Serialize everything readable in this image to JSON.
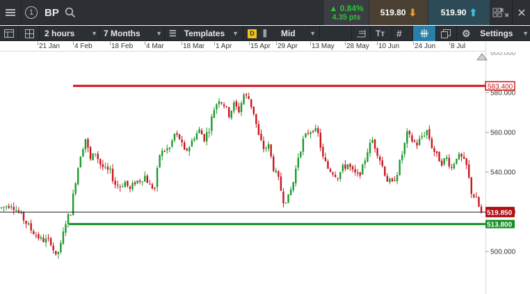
{
  "header": {
    "instrument_number": "1",
    "symbol": "BP",
    "change_pct": "0.84%",
    "change_pts": "4.35 pts",
    "sell_price": "519.80",
    "buy_price": "519.90"
  },
  "toolbar": {
    "interval": "2 hours",
    "range": "7 Months",
    "templates_label": "Templates",
    "d_badge": "D",
    "price_type": "Mid",
    "settings_label": "Settings"
  },
  "colors": {
    "up_candle": "#1a9a2a",
    "down_candle": "#c8141c",
    "resistance": "#d41016",
    "support": "#138f21",
    "current": "#b01012"
  },
  "chart_data": {
    "type": "candlestick",
    "x_tick_labels": [
      "21 Jan",
      "4 Feb",
      "18 Feb",
      "4 Mar",
      "18 Mar",
      "1 Apr",
      "15 Apr",
      "29 Apr",
      "13 May",
      "28 May",
      "10 Jun",
      "24 Jun",
      "8 Jul"
    ],
    "y_tick_labels": [
      "500.000",
      "520.000",
      "540.000",
      "560.000",
      "580.000",
      "600.000"
    ],
    "ylim": [
      487,
      604
    ],
    "anchors": [
      [
        0,
        522
      ],
      [
        4,
        524
      ],
      [
        8,
        518
      ],
      [
        12,
        511
      ],
      [
        16,
        506
      ],
      [
        20,
        505
      ],
      [
        22,
        497
      ],
      [
        24,
        503
      ],
      [
        26,
        515
      ],
      [
        28,
        520
      ],
      [
        30,
        536
      ],
      [
        32,
        549
      ],
      [
        34,
        557
      ],
      [
        36,
        546
      ],
      [
        38,
        550
      ],
      [
        40,
        544
      ],
      [
        42,
        541
      ],
      [
        44,
        540
      ],
      [
        46,
        534
      ],
      [
        48,
        533
      ],
      [
        50,
        535
      ],
      [
        52,
        531
      ],
      [
        54,
        535
      ],
      [
        56,
        536
      ],
      [
        58,
        538
      ],
      [
        60,
        533
      ],
      [
        62,
        532
      ],
      [
        64,
        549
      ],
      [
        66,
        551
      ],
      [
        68,
        552
      ],
      [
        70,
        559
      ],
      [
        72,
        557
      ],
      [
        74,
        550
      ],
      [
        76,
        553
      ],
      [
        78,
        558
      ],
      [
        80,
        561
      ],
      [
        82,
        557
      ],
      [
        84,
        562
      ],
      [
        86,
        572
      ],
      [
        88,
        577
      ],
      [
        90,
        574
      ],
      [
        92,
        569
      ],
      [
        94,
        574
      ],
      [
        96,
        571
      ],
      [
        98,
        579
      ],
      [
        100,
        577
      ],
      [
        102,
        570
      ],
      [
        104,
        558
      ],
      [
        106,
        552
      ],
      [
        108,
        553
      ],
      [
        110,
        542
      ],
      [
        112,
        536
      ],
      [
        114,
        526
      ],
      [
        116,
        527
      ],
      [
        118,
        535
      ],
      [
        120,
        548
      ],
      [
        122,
        556
      ],
      [
        124,
        560
      ],
      [
        126,
        562
      ],
      [
        128,
        559
      ],
      [
        130,
        547
      ],
      [
        132,
        542
      ],
      [
        134,
        540
      ],
      [
        136,
        538
      ],
      [
        138,
        542
      ],
      [
        140,
        544
      ],
      [
        142,
        540
      ],
      [
        144,
        538
      ],
      [
        146,
        542
      ],
      [
        148,
        551
      ],
      [
        150,
        556
      ],
      [
        152,
        550
      ],
      [
        154,
        543
      ],
      [
        156,
        536
      ],
      [
        158,
        534
      ],
      [
        160,
        540
      ],
      [
        162,
        549
      ],
      [
        164,
        559
      ],
      [
        166,
        556
      ],
      [
        168,
        554
      ],
      [
        170,
        558
      ],
      [
        172,
        561
      ],
      [
        174,
        553
      ],
      [
        176,
        548
      ],
      [
        178,
        545
      ],
      [
        180,
        547
      ],
      [
        182,
        542
      ],
      [
        184,
        548
      ],
      [
        186,
        547
      ],
      [
        188,
        543
      ],
      [
        190,
        530
      ],
      [
        192,
        526
      ],
      [
        194,
        519
      ]
    ],
    "current_price": 519.85,
    "support_level": 513.8,
    "resistance_level": 583.4,
    "current_label": "519.850",
    "support_label": "513.800",
    "resistance_label": "583.400",
    "top_label": "600.000",
    "grid": false,
    "legend": "none"
  }
}
